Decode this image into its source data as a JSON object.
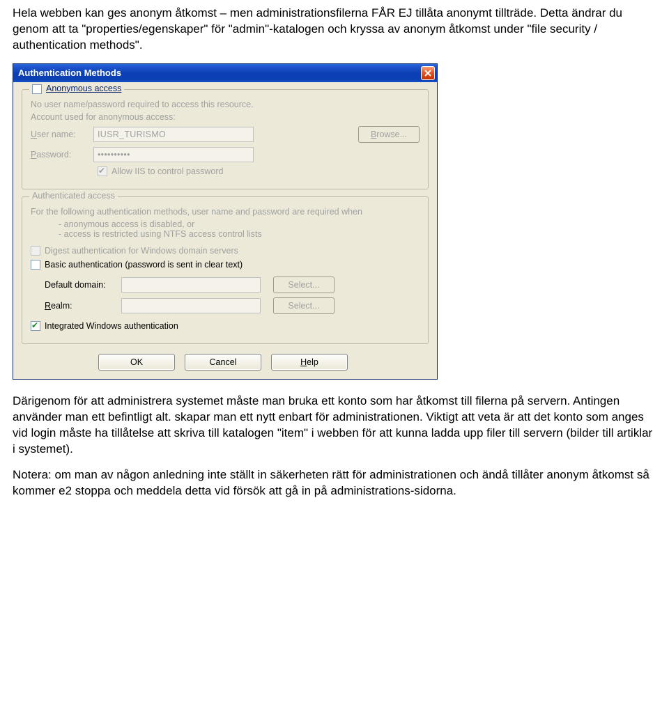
{
  "doc": {
    "p1": "Hela webben kan ges anonym åtkomst – men administrationsfilerna FÅR EJ tillåta anonymt tillträde. Detta ändrar du genom att ta \"properties/egenskaper\" för \"admin\"-katalogen och kryssa av anonym åtkomst under \"file security / authentication methods\".",
    "p2": "Därigenom för att administrera systemet måste man bruka ett konto som har åtkomst till filerna på servern. Antingen använder man ett befintligt alt. skapar man ett nytt enbart för administrationen. Viktigt att veta är att det konto som anges vid login måste ha tillåtelse att skriva till katalogen \"item\" i webben för att kunna ladda upp filer till servern (bilder till artiklar i systemet).",
    "p3": "Notera: om man av någon anledning inte ställt in säkerheten rätt för administrationen och ändå tillåter anonym åtkomst så kommer e2 stoppa och meddela detta vid försök att gå in på administrations-sidorna."
  },
  "dialog": {
    "title": "Authentication Methods",
    "anon": {
      "legend": "Anonymous access",
      "desc": "No user name/password required to access this resource.",
      "accountLine": "Account used for anonymous access:",
      "userLabel": "User name:",
      "userValue": "IUSR_TURISMO",
      "browse": "Browse...",
      "passLabel": "Password:",
      "passValue": "••••••••••",
      "allowIIS": "Allow IIS to control password"
    },
    "auth": {
      "legend": "Authenticated access",
      "desc": "For the following authentication methods, user name and password are required when",
      "bullet1": "- anonymous access is disabled, or",
      "bullet2": "- access is restricted using NTFS access control lists",
      "digest": "Digest authentication for Windows domain servers",
      "basic": "Basic authentication (password is sent in clear text)",
      "defaultDomain": "Default domain:",
      "realm": "Realm:",
      "select": "Select...",
      "integrated": "Integrated Windows authentication"
    },
    "buttons": {
      "ok": "OK",
      "cancel": "Cancel",
      "help": "Help"
    }
  }
}
